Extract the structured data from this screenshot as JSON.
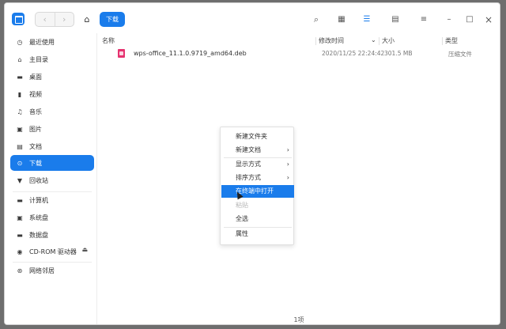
{
  "toolbar": {
    "back": "‹",
    "forward": "›",
    "home": "⌂",
    "breadcrumb": "下载",
    "search": "⌕",
    "icon_view": "▦",
    "list_view": "☰",
    "detail_view": "▤",
    "menu": "≡",
    "minimize": "–",
    "maximize": "□",
    "close": "×"
  },
  "sidebar": {
    "items": [
      {
        "label": "最近使用",
        "icon": "clock-icon",
        "glyph": "◷"
      },
      {
        "label": "主目录",
        "icon": "home-icon",
        "glyph": "⌂"
      },
      {
        "label": "桌面",
        "icon": "desktop-icon",
        "glyph": "▬"
      },
      {
        "label": "视频",
        "icon": "video-icon",
        "glyph": "▮"
      },
      {
        "label": "音乐",
        "icon": "music-icon",
        "glyph": "♫"
      },
      {
        "label": "图片",
        "icon": "picture-icon",
        "glyph": "▣"
      },
      {
        "label": "文档",
        "icon": "document-icon",
        "glyph": "▤"
      },
      {
        "label": "下载",
        "icon": "download-icon",
        "glyph": "⊙"
      },
      {
        "label": "回收站",
        "icon": "trash-icon",
        "glyph": "▼"
      },
      {
        "label": "计算机",
        "icon": "computer-icon",
        "glyph": "▬"
      },
      {
        "label": "系统盘",
        "icon": "disk-icon",
        "glyph": "▣"
      },
      {
        "label": "数据盘",
        "icon": "disk-icon",
        "glyph": "▬"
      },
      {
        "label": "CD-ROM 驱动器",
        "icon": "cdrom-icon",
        "glyph": "◉",
        "eject": "⏏"
      },
      {
        "label": "网络邻居",
        "icon": "network-icon",
        "glyph": "⊛"
      }
    ]
  },
  "columns": {
    "name": "名称",
    "modified": "修改时间",
    "sort_indicator": "⌄",
    "size": "大小",
    "type": "类型"
  },
  "files": [
    {
      "name": "wps-office_11.1.0.9719_amd64.deb",
      "modified": "2020/11/25 22:24:42",
      "size": "301.5 MB",
      "type": "压缩文件"
    }
  ],
  "context_menu": {
    "items": [
      {
        "label": "新建文件夹"
      },
      {
        "label": "新建文档",
        "arrow": "›"
      },
      {
        "label": "显示方式",
        "arrow": "›"
      },
      {
        "label": "排序方式",
        "arrow": "›"
      },
      {
        "label": "在终端中打开"
      },
      {
        "label": "粘贴"
      },
      {
        "label": "全选"
      },
      {
        "label": "属性"
      }
    ]
  },
  "status": {
    "count": "1项"
  },
  "colors": {
    "accent": "#1a7ceb",
    "file_icon": "#e63370"
  }
}
